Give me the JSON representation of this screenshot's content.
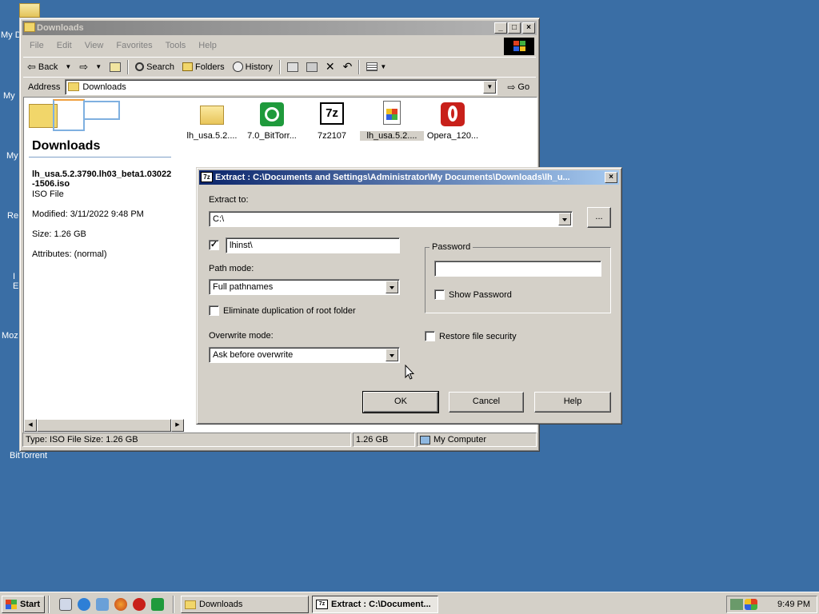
{
  "desktop": {
    "labels": [
      "My D",
      "My",
      "My",
      "Re",
      "I",
      "E",
      "Moz",
      "BitTorrent"
    ]
  },
  "explorer": {
    "title": "Downloads",
    "menu": [
      "File",
      "Edit",
      "View",
      "Favorites",
      "Tools",
      "Help"
    ],
    "toolbar": {
      "back": "Back",
      "search": "Search",
      "folders": "Folders",
      "history": "History"
    },
    "address": {
      "label": "Address",
      "value": "Downloads",
      "go": "Go"
    },
    "panel": {
      "title": "Downloads",
      "filename": "lh_usa.5.2.3790.lh03_beta1.03022",
      "filename2": "-1506.iso",
      "filetype": "ISO File",
      "modified": "Modified: 3/11/2022 9:48 PM",
      "size": "Size: 1.26 GB",
      "attributes": "Attributes: (normal)"
    },
    "files": [
      {
        "label": "lh_usa.5.2....",
        "icon": "folder-icon"
      },
      {
        "label": "7.0_BitTorr...",
        "icon": "bittorrent-icon"
      },
      {
        "label": "7z2107",
        "icon": "sevenzip-icon"
      },
      {
        "label": "lh_usa.5.2....",
        "icon": "iso-file-icon"
      },
      {
        "label": "Opera_120...",
        "icon": "opera-icon"
      }
    ],
    "status": {
      "left": "Type: ISO File Size: 1.26 GB",
      "size": "1.26 GB",
      "zone": "My Computer"
    }
  },
  "dialog": {
    "title": "Extract : C:\\Documents and Settings\\Administrator\\My Documents\\Downloads\\lh_u...",
    "extract_to_label": "Extract to:",
    "extract_to_value": "C:\\",
    "browse": "...",
    "subfolder_value": "lhinst\\",
    "path_mode_label": "Path mode:",
    "path_mode_value": "Full pathnames",
    "eliminate_label": "Eliminate duplication of root folder",
    "overwrite_label": "Overwrite mode:",
    "overwrite_value": "Ask before overwrite",
    "password_group": "Password",
    "show_password": "Show Password",
    "restore_security": "Restore file security",
    "ok": "OK",
    "cancel": "Cancel",
    "help": "Help"
  },
  "taskbar": {
    "start": "Start",
    "task1": "Downloads",
    "task2": "Extract : C:\\Document...",
    "clock": "9:49 PM"
  },
  "colors": {
    "desktop": "#3a6ea5",
    "titlebar_active": "#0a246a",
    "face": "#d4d0c8"
  }
}
